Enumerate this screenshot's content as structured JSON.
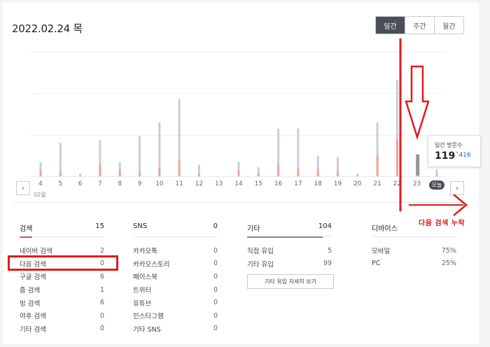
{
  "header": {
    "date": "2022.02.24 목",
    "period_tabs": [
      "일간",
      "주간",
      "월간"
    ],
    "active_tab": 0
  },
  "chart_data": {
    "type": "bar",
    "categories": [
      "4",
      "5",
      "6",
      "7",
      "8",
      "9",
      "10",
      "11",
      "12",
      "13",
      "14",
      "15",
      "16",
      "17",
      "18",
      "19",
      "20",
      "21",
      "22",
      "23",
      "오늘"
    ],
    "month_label": "02월",
    "series": [
      {
        "values": [
          22,
          52,
          4,
          56,
          22,
          62,
          84,
          120,
          18,
          0,
          22,
          14,
          74,
          74,
          32,
          30,
          4,
          84,
          150,
          34,
          11
        ]
      },
      {
        "values": [
          10,
          6,
          1,
          18,
          10,
          6,
          14,
          24,
          4,
          0,
          9,
          4,
          18,
          12,
          12,
          8,
          1,
          32,
          58,
          2,
          1
        ]
      }
    ],
    "colors": {
      "total": "#c9ced3",
      "accent": "#f3a394"
    },
    "highlight_index": 19
  },
  "tooltip": {
    "label": "일간 방문수",
    "value": "119",
    "delta": "˅416"
  },
  "nav": {
    "prev": "‹",
    "next": "›"
  },
  "stats": {
    "search": {
      "title": "검색",
      "total": "15",
      "rows": [
        {
          "label": "네이버 검색",
          "value": "2"
        },
        {
          "label": "다음 검색",
          "value": "0"
        },
        {
          "label": "구글 검색",
          "value": "6"
        },
        {
          "label": "줌 검색",
          "value": "1"
        },
        {
          "label": "빙 검색",
          "value": "6"
        },
        {
          "label": "야후 검색",
          "value": "0"
        },
        {
          "label": "기타 검색",
          "value": "0"
        }
      ]
    },
    "sns": {
      "title": "SNS",
      "total": "0",
      "rows": [
        {
          "label": "카카오톡",
          "value": "0"
        },
        {
          "label": "카카오스토리",
          "value": "0"
        },
        {
          "label": "페이스북",
          "value": "0"
        },
        {
          "label": "트위터",
          "value": "0"
        },
        {
          "label": "유튜브",
          "value": "0"
        },
        {
          "label": "인스타그램",
          "value": "0"
        },
        {
          "label": "기타 SNS",
          "value": "0"
        }
      ]
    },
    "etc": {
      "title": "기타",
      "total": "104",
      "rows": [
        {
          "label": "직접 유입",
          "value": "5"
        },
        {
          "label": "기타 유입",
          "value": "99"
        }
      ],
      "detail_button": "기타 유입 자세히 보기"
    },
    "device": {
      "title": "디바이스",
      "rows": [
        {
          "label": "모바일",
          "value": "75%"
        },
        {
          "label": "PC",
          "value": "25%"
        }
      ]
    }
  },
  "annotation": {
    "text": "다음 검색 누락",
    "color": "#e21b1b"
  }
}
